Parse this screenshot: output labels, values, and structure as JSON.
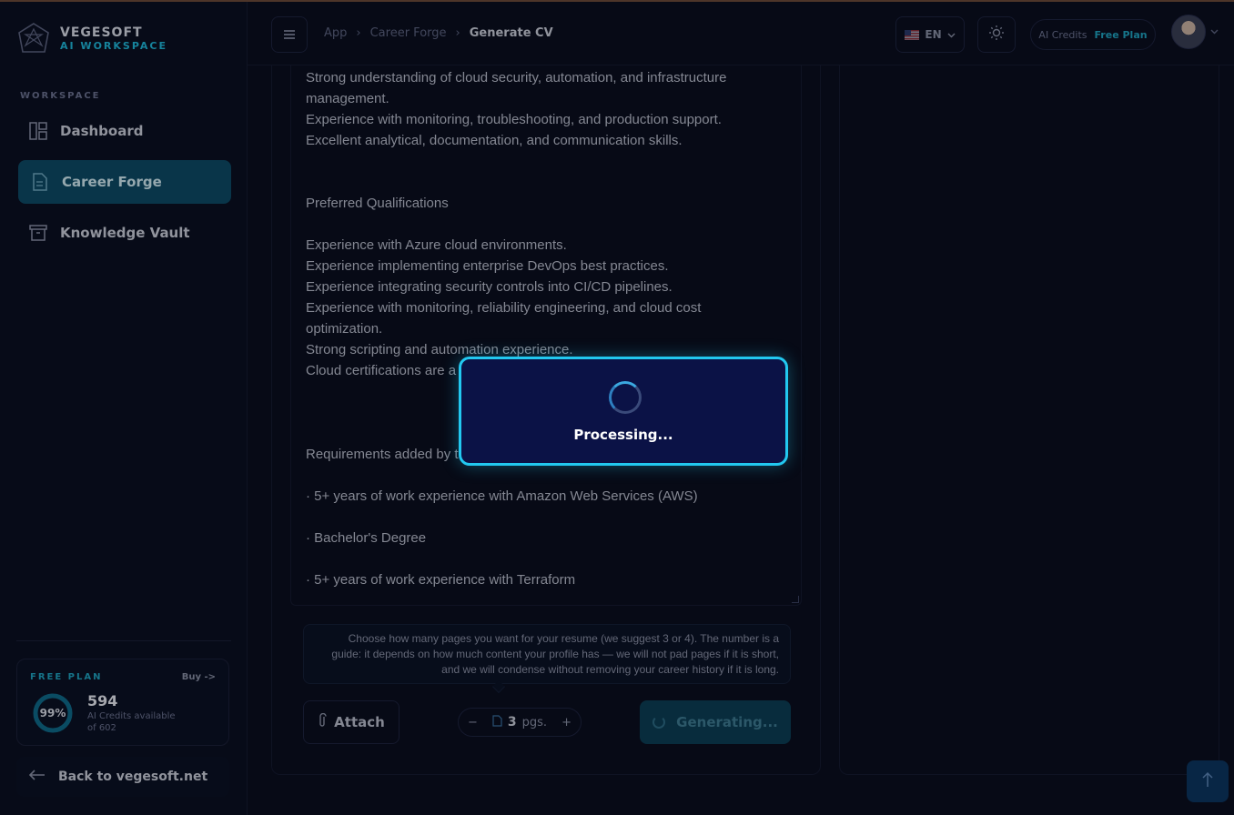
{
  "brand": {
    "name": "VEGESOFT",
    "subtitle": "AI WORKSPACE"
  },
  "sidebar": {
    "section_label": "WORKSPACE",
    "items": [
      {
        "label": "Dashboard",
        "icon": "dashboard-icon",
        "active": false
      },
      {
        "label": "Career Forge",
        "icon": "document-icon",
        "active": true
      },
      {
        "label": "Knowledge Vault",
        "icon": "archive-icon",
        "active": false
      }
    ],
    "plan": {
      "label": "FREE PLAN",
      "buy": "Buy ->",
      "percent_text": "99%",
      "percent": 99,
      "credits": "594",
      "credits_caption": "AI Credits available",
      "credits_of": "of 602"
    },
    "back_link": "Back to vegesoft.net"
  },
  "header": {
    "breadcrumb": [
      "App",
      "Career Forge",
      "Generate CV"
    ],
    "language": "EN",
    "credits_label": "AI Credits",
    "plan_name": "Free Plan"
  },
  "job_description": {
    "lines": [
      "Strong understanding of cloud security, automation, and infrastructure",
      "management.",
      "Experience with monitoring, troubleshooting, and production support.",
      "Excellent analytical, documentation, and communication skills.",
      "",
      "",
      "Preferred Qualifications",
      "",
      "Experience with Azure cloud environments.",
      "Experience implementing enterprise DevOps best practices.",
      "Experience integrating security controls into CI/CD pipelines.",
      "Experience with monitoring, reliability engineering, and cloud cost",
      "optimization.",
      "Strong scripting and automation experience.",
      "Cloud certifications are a",
      "",
      "",
      "",
      "Requirements added by t",
      "",
      "· 5+ years of work experience with Amazon Web Services (AWS)",
      "",
      "· Bachelor's Degree",
      "",
      "· 5+ years of work experience with Terraform"
    ]
  },
  "tip": "Choose how many pages you want for your resume (we suggest 3 or 4). The number is a guide: it depends on how much content your profile has — we will not pad pages if it is short, and we will condense without removing your career history if it is long.",
  "actions": {
    "attach_label": "Attach",
    "pages_value": "3",
    "pages_unit": "pgs.",
    "minus": "−",
    "plus": "+",
    "generate_label": "Generating..."
  },
  "modal": {
    "text": "Processing..."
  },
  "colors": {
    "accent": "#22c8f0",
    "active_nav": "#0d4a66",
    "plan_link": "#1fa2c0"
  }
}
